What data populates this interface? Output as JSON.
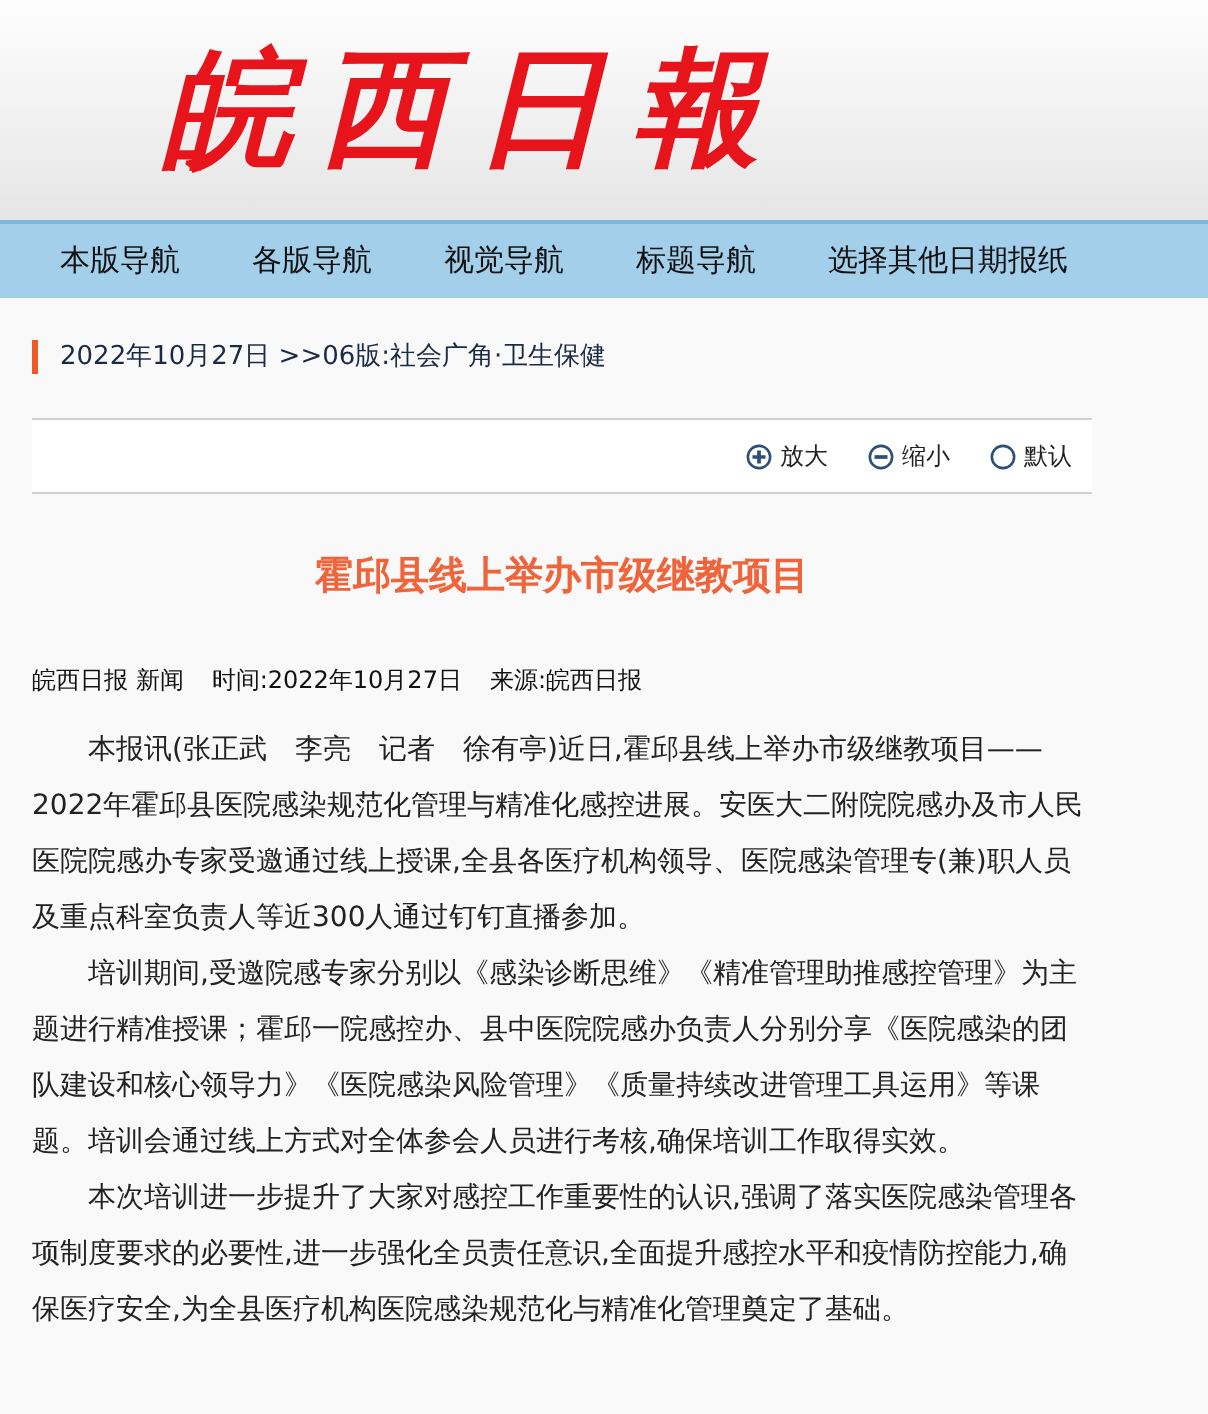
{
  "logo": "皖西日報",
  "nav": [
    "本版导航",
    "各版导航",
    "视觉导航",
    "标题导航",
    "选择其他日期报纸"
  ],
  "breadcrumb": "2022年10月27日 >>06版:社会广角·卫生保健",
  "tools": [
    {
      "kind": "plus",
      "label": "放大"
    },
    {
      "kind": "minus",
      "label": "缩小"
    },
    {
      "kind": "circle",
      "label": "默认"
    }
  ],
  "title": "霍邱县线上举办市级继教项目",
  "meta": [
    "皖西日报 新闻",
    "时间:2022年10月27日",
    "来源:皖西日报"
  ],
  "paragraphs": [
    "本报讯(张正武　李亮　记者　徐有亭)近日,霍邱县线上举办市级继教项目——2022年霍邱县医院感染规范化管理与精准化感控进展。安医大二附院院感办及市人民医院院感办专家受邀通过线上授课,全县各医疗机构领导、医院感染管理专(兼)职人员及重点科室负责人等近300人通过钉钉直播参加。",
    "培训期间,受邀院感专家分别以《感染诊断思维》《精准管理助推感控管理》为主题进行精准授课；霍邱一院感控办、县中医院院感办负责人分别分享《医院感染的团队建设和核心领导力》《医院感染风险管理》《质量持续改进管理工具运用》等课题。培训会通过线上方式对全体参会人员进行考核,确保培训工作取得实效。",
    "本次培训进一步提升了大家对感控工作重要性的认识,强调了落实医院感染管理各项制度要求的必要性,进一步强化全员责任意识,全面提升感控水平和疫情防控能力,确保医疗安全,为全县医疗机构医院感染规范化与精准化管理奠定了基础。"
  ]
}
